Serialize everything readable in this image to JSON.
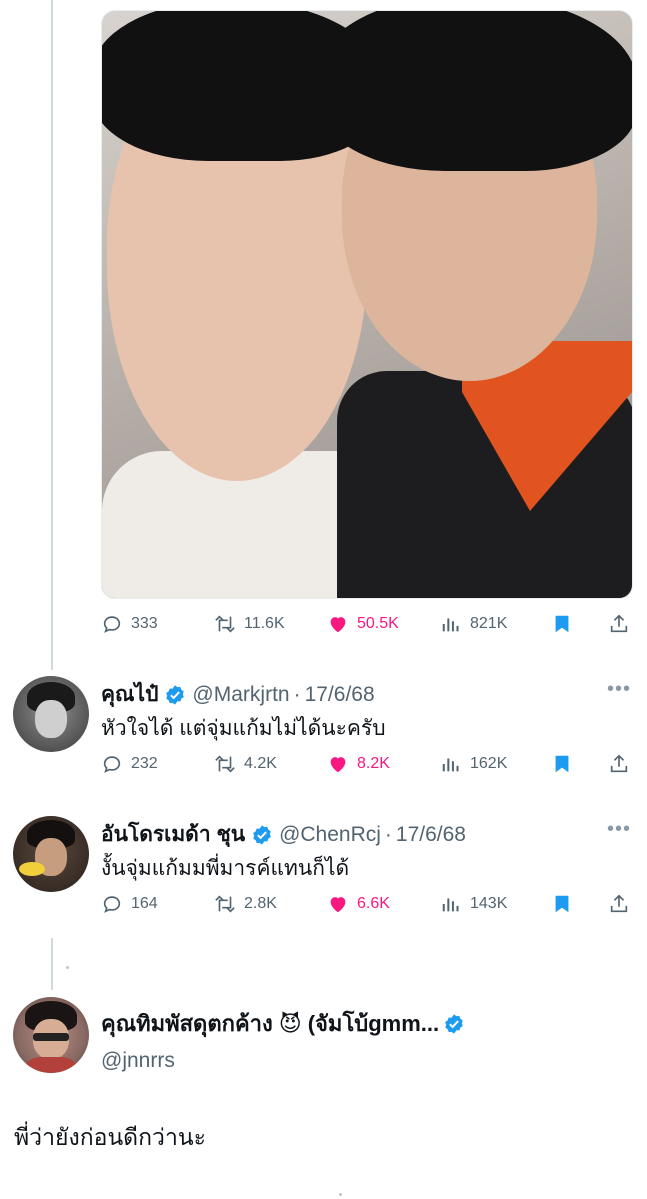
{
  "main_tweet": {
    "photo_alt": "",
    "stats": {
      "replies": "333",
      "retweets": "11.6K",
      "likes": "50.5K",
      "views": "821K"
    }
  },
  "replies": [
    {
      "name": "คุณไป๋",
      "handle": "@Markjrtn",
      "sep": "·",
      "date": "17/6/68",
      "text": "หัวใจได้ แต่จุ่มแก้มไม่ได้นะครับ",
      "stats": {
        "replies": "232",
        "retweets": "4.2K",
        "likes": "8.2K",
        "views": "162K"
      }
    },
    {
      "name": "อันโดรเมด้า ชุน",
      "handle": "@ChenRcj",
      "sep": "·",
      "date": "17/6/68",
      "text": "งั้นจุ่มแก้มมพี่มารค์แทนก็ได้",
      "stats": {
        "replies": "164",
        "retweets": "2.8K",
        "likes": "6.6K",
        "views": "143K"
      }
    }
  ],
  "quote": {
    "name_part1": "คุณทิมพัสดุตกค้าง",
    "emoji": "😈",
    "name_part2": "(จัมโบ้gmm...",
    "handle": "@jnnrrs",
    "body": "พี่ว่ายังก่อนดีกว่านะ"
  },
  "colors": {
    "accent": "#1d9bf0",
    "like": "#f91880",
    "muted": "#536471",
    "line": "#cfd9de"
  }
}
